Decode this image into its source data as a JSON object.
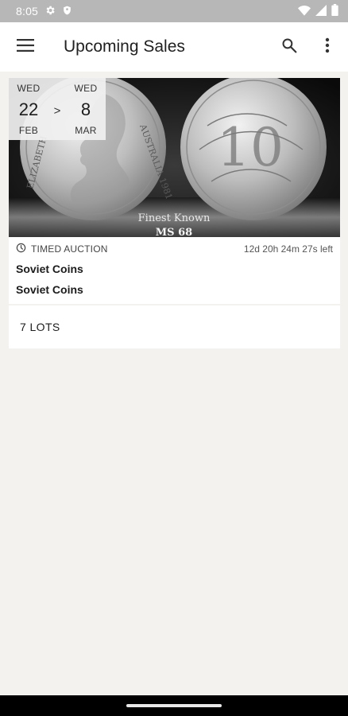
{
  "status_bar": {
    "time": "8:05",
    "icons": [
      "gear-icon",
      "shield-icon",
      "wifi-icon",
      "signal-icon",
      "battery-icon"
    ]
  },
  "app_bar": {
    "title": "Upcoming Sales",
    "icons": [
      "menu-icon",
      "search-icon",
      "more-vert-icon"
    ]
  },
  "sale": {
    "start": {
      "dow": "WED",
      "day": "22",
      "month": "FEB"
    },
    "separator": ">",
    "end": {
      "dow": "WED",
      "day": "8",
      "month": "MAR"
    },
    "image_captions": {
      "finest": "Finest Known",
      "grade": "MS 68",
      "obverse_legend": "AUSTRALIA 1981",
      "obverse_left": "ELIZABETH",
      "reverse_value": "10"
    },
    "type": "TIMED AUCTION",
    "countdown": "12d 20h 24m 27s left",
    "title": "Soviet Coins",
    "subtitle": "Soviet Coins",
    "lots": "7 LOTS"
  },
  "colors": {
    "background": "#f3f2ef",
    "status_bar": "#b7b7b7",
    "card": "#ffffff",
    "nav_bar": "#000000"
  }
}
